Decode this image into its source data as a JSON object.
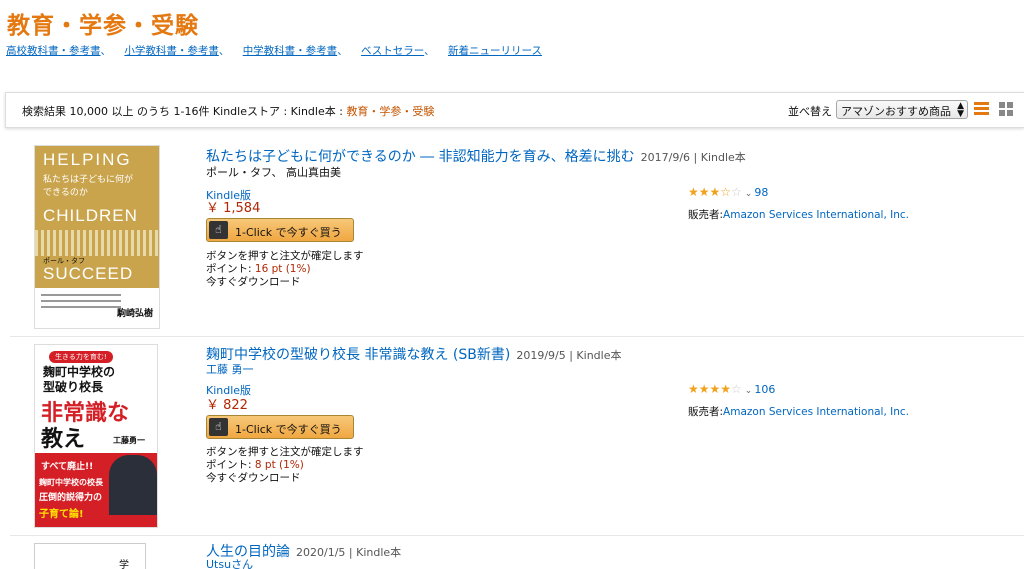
{
  "page_title": "教育・学参・受験",
  "category_links": [
    "高校教科書・参考書",
    "小学教科書・参考書",
    "中学教科書・参考書",
    "ベストセラー",
    "新着ニューリリース"
  ],
  "result_bar": {
    "summary": "検索結果 10,000 以上 のうち 1-16件 Kindleストア : Kindle本 : ",
    "crumb": "教育・学参・受験",
    "sort_label": "並べ替え",
    "sort_value": "アマゾンおすすめ商品"
  },
  "products": [
    {
      "title": "私たちは子どもに何ができるのか ― 非認知能力を育み、格差に挑む",
      "meta": "2017/9/6 | Kindle本",
      "author": "ポール・タフ、 高山真由美",
      "format": "Kindle版",
      "price": "￥ 1,584",
      "buy_label": "1-Click で今すぐ買う",
      "confirm_text": "ボタンを押すと注文が確定します",
      "points_label": "ポイント: ",
      "points": "16 pt (1%)",
      "download_text": "今すぐダウンロード",
      "rating": 3.5,
      "review_count": "98",
      "seller_label": "販売者:",
      "seller": "Amazon Services International, Inc.",
      "cover": {
        "top": "HELPING",
        "middle": "CHILDREN",
        "bottom": "SUCCEED",
        "jp": "私たちは子どもに何ができるのか",
        "author_jp": "ポール・タフ",
        "badge": "駒崎弘樹"
      }
    },
    {
      "title": "麹町中学校の型破り校長 非常識な教え (SB新書)",
      "meta": "2019/9/5 | Kindle本",
      "author": "工藤 勇一",
      "format": "Kindle版",
      "price": "￥ 822",
      "buy_label": "1-Click で今すぐ買う",
      "confirm_text": "ボタンを押すと注文が確定します",
      "points_label": "ポイント: ",
      "points": "8 pt (1%)",
      "download_text": "今すぐダウンロード",
      "rating": 4.5,
      "review_count": "106",
      "seller_label": "販売者:",
      "seller": "Amazon Services International, Inc.",
      "cover": {
        "banner": "生きる力を育む!",
        "line1": "麹町中学校の",
        "line2": "型破り校長",
        "big1": "非常識な",
        "big2": "教え",
        "author_jp": "工藤勇一",
        "red1": "すべて廃止!!",
        "red2": "麹町中学校の校長",
        "red3": "圧倒的説得力の",
        "red4": "子育て論!"
      }
    },
    {
      "title": "人生の目的論",
      "meta": "2020/1/5 | Kindle本",
      "author": "Utsuさん",
      "cover": {
        "char": "学"
      }
    }
  ],
  "colors": {
    "accent": "#e47911",
    "link": "#0066c0",
    "price": "#b12704",
    "star": "#f0a21b"
  }
}
